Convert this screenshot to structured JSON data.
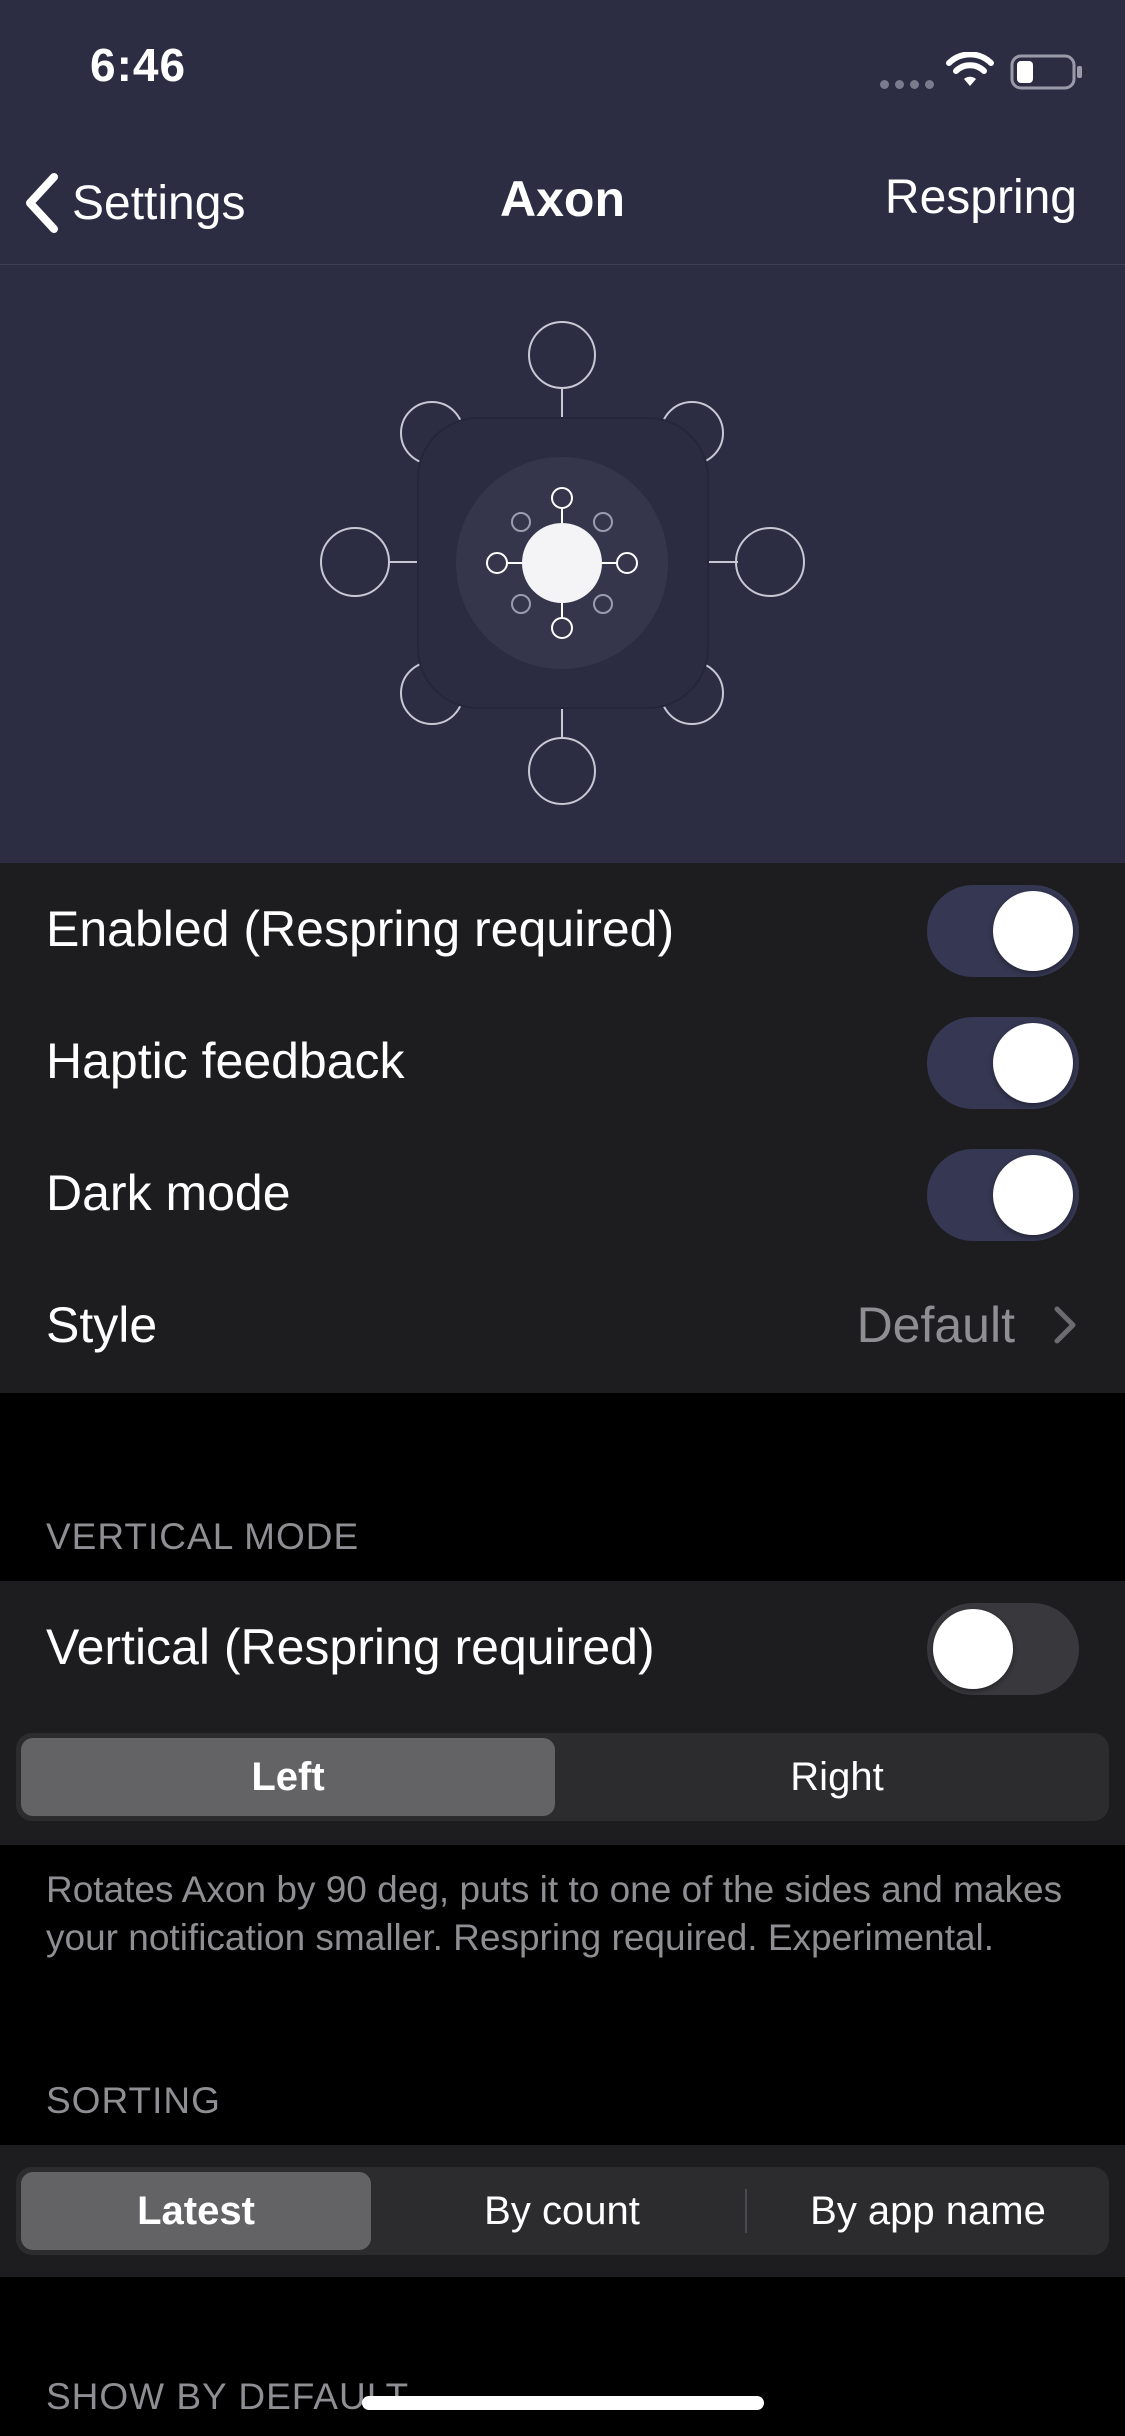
{
  "status_bar": {
    "time": "6:46",
    "signal_icon": "cellular-dots-icon",
    "wifi_icon": "wifi-icon",
    "battery_icon": "battery-icon"
  },
  "navbar": {
    "back_label": "Settings",
    "title": "Axon",
    "action_label": "Respring"
  },
  "colors": {
    "header_bg": "#2c2d43",
    "group_bg": "#1d1d1f",
    "toggle_on": "#363853",
    "secondary_text": "#8e8e93"
  },
  "settings": {
    "enabled": {
      "label": "Enabled (Respring required)",
      "on": true
    },
    "haptic": {
      "label": "Haptic feedback",
      "on": true
    },
    "dark_mode": {
      "label": "Dark mode",
      "on": true
    },
    "style": {
      "label": "Style",
      "value": "Default"
    }
  },
  "vertical_mode": {
    "header": "VERTICAL MODE",
    "vertical": {
      "label": "Vertical (Respring required)",
      "on": false
    },
    "side_options": [
      "Left",
      "Right"
    ],
    "selected_side": "Left",
    "footer": "Rotates Axon by 90 deg, puts it to one of the sides and makes your notification smaller. Respring required. Experimental."
  },
  "sorting": {
    "header": "SORTING",
    "options": [
      "Latest",
      "By count",
      "By app name"
    ],
    "selected": "Latest"
  },
  "show_by_default": {
    "header": "SHOW BY DEFAULT"
  }
}
